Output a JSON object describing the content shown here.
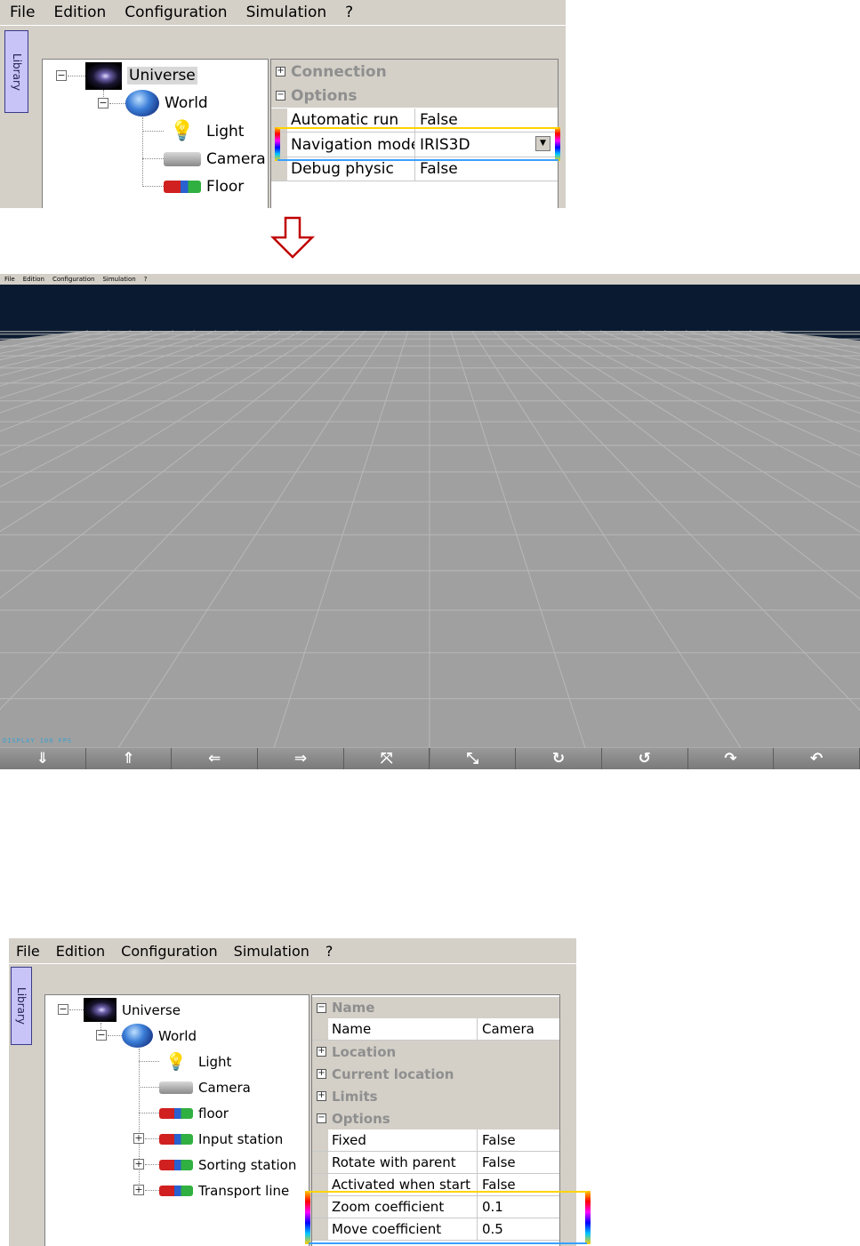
{
  "menu": [
    "File",
    "Edition",
    "Configuration",
    "Simulation",
    "?"
  ],
  "library_tab": "Library",
  "top": {
    "tree": {
      "universe": "Universe",
      "world": "World",
      "children": [
        "Light",
        "Camera",
        "Floor"
      ]
    },
    "properties": {
      "categories": [
        "Connection",
        "Options"
      ],
      "rows": [
        {
          "key": "Automatic run",
          "value": "False"
        },
        {
          "key": "Navigation mode",
          "value": "IRIS3D"
        },
        {
          "key": "Debug physic",
          "value": "False"
        }
      ]
    }
  },
  "arrow_color": "#c00000",
  "middle": {
    "menu": [
      "File",
      "Edition",
      "Configuration",
      "Simulation",
      "?"
    ],
    "status_text": "DISPLAY 100 FPS",
    "sky_color": "#0a1a30",
    "floor_color": "#a0a0a0",
    "toolbar": [
      {
        "icon": "arrow-down-icon",
        "glyph": "⇓"
      },
      {
        "icon": "arrow-up-icon",
        "glyph": "⇑"
      },
      {
        "icon": "arrow-left-icon",
        "glyph": "⇐"
      },
      {
        "icon": "arrow-right-icon",
        "glyph": "⇒"
      },
      {
        "icon": "zoom-in-icon",
        "glyph": "⤧"
      },
      {
        "icon": "zoom-out-icon",
        "glyph": "⤡"
      },
      {
        "icon": "rotate-right-icon",
        "glyph": "↻"
      },
      {
        "icon": "rotate-left-icon",
        "glyph": "↺"
      },
      {
        "icon": "tilt-up-icon",
        "glyph": "↷"
      },
      {
        "icon": "tilt-down-icon",
        "glyph": "↶"
      }
    ]
  },
  "bottom": {
    "tree": {
      "universe": "Universe",
      "world": "World",
      "children": [
        "Light",
        "Camera",
        "floor",
        "Input station",
        "Sorting station",
        "Transport line"
      ]
    },
    "properties": {
      "name_category": "Name",
      "name_row": {
        "key": "Name",
        "value": "Camera"
      },
      "collapsed_categories": [
        "Location",
        "Current location",
        "Limits"
      ],
      "options_category": "Options",
      "rows": [
        {
          "key": "Fixed",
          "value": "False"
        },
        {
          "key": "Rotate with parent",
          "value": "False"
        },
        {
          "key": "Activated when start",
          "value": "False"
        },
        {
          "key": "Zoom coefficient",
          "value": "0.1"
        },
        {
          "key": "Move coefficient",
          "value": "0.5"
        }
      ]
    }
  }
}
